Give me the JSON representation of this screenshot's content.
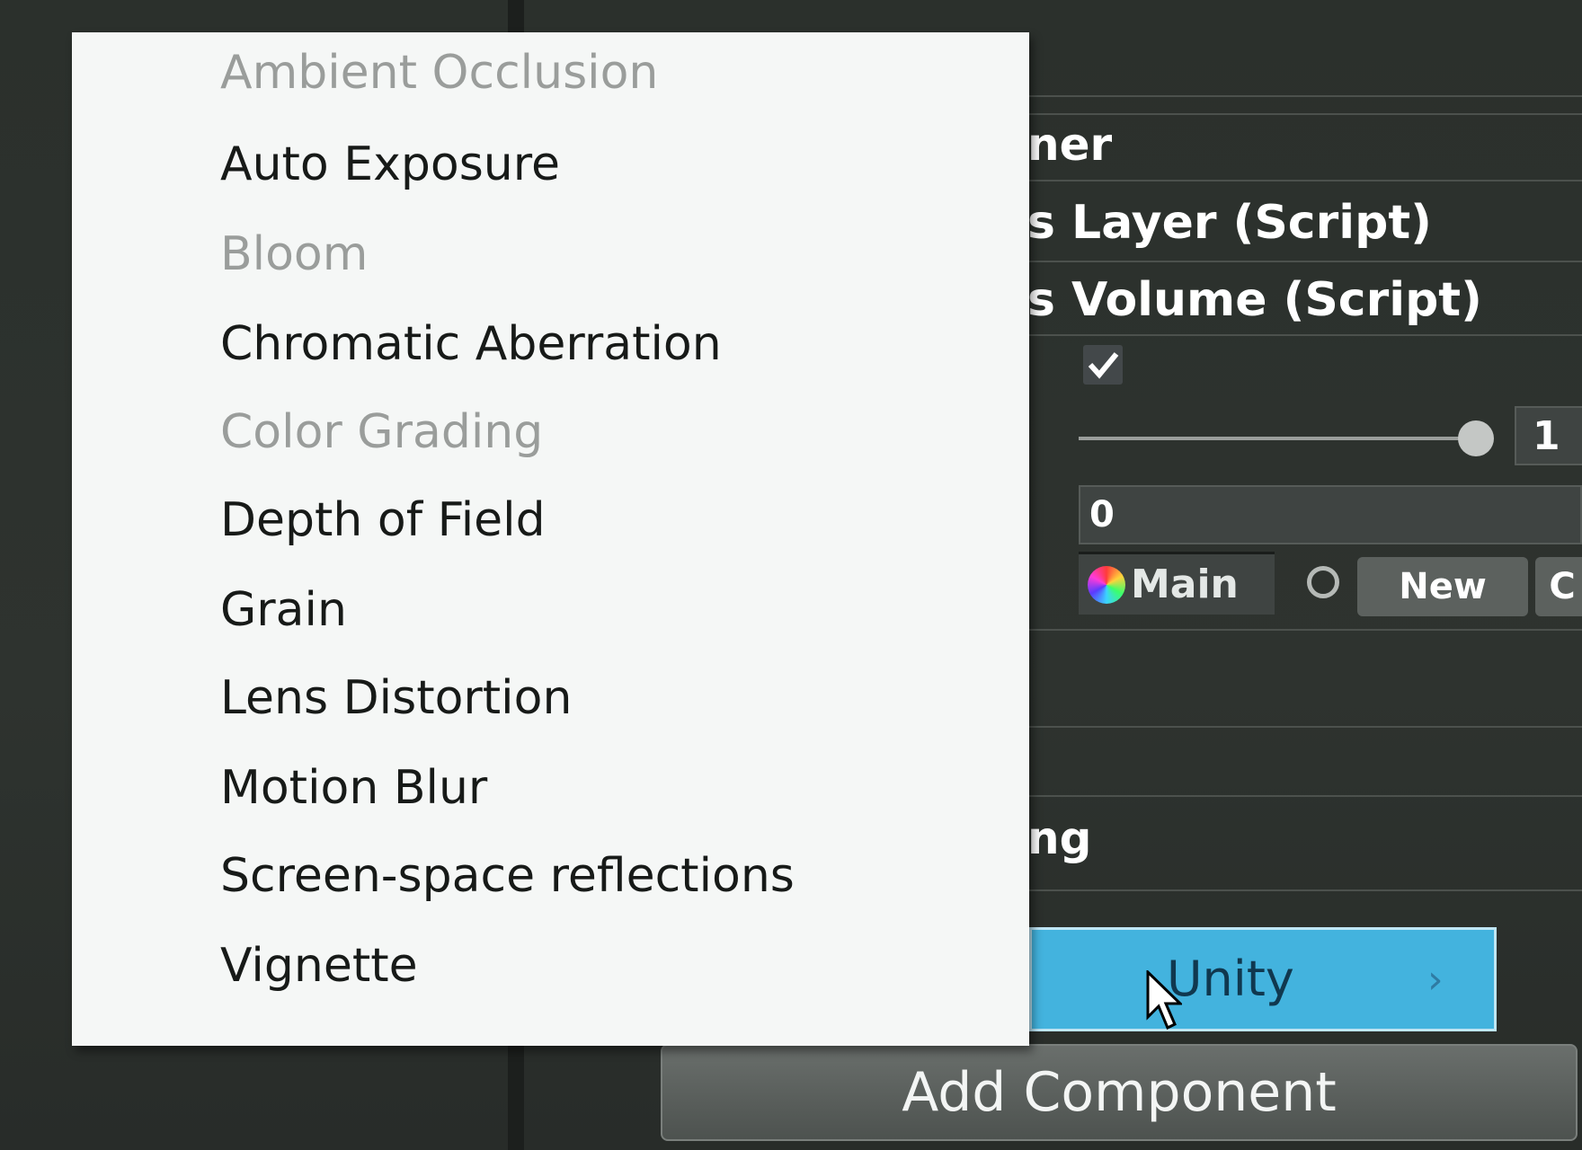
{
  "inspector": {
    "fragments": {
      "name_tail": "ner",
      "layer_component": "s Layer (Script)",
      "volume_component": "s Volume (Script)",
      "section_tail": "ng"
    },
    "is_global_checked": true,
    "weight": {
      "value": "1",
      "fraction": 1.0
    },
    "priority": {
      "value": "0"
    },
    "profile": {
      "value": "Main",
      "new_button": "New",
      "clone_button": "C"
    }
  },
  "context_menu": {
    "items": [
      {
        "label": "Ambient Occlusion",
        "enabled": false
      },
      {
        "label": "Auto Exposure",
        "enabled": true
      },
      {
        "label": "Bloom",
        "enabled": false
      },
      {
        "label": "Chromatic Aberration",
        "enabled": true
      },
      {
        "label": "Color Grading",
        "enabled": false
      },
      {
        "label": "Depth of Field",
        "enabled": true
      },
      {
        "label": "Grain",
        "enabled": true
      },
      {
        "label": "Lens Distortion",
        "enabled": true
      },
      {
        "label": "Motion Blur",
        "enabled": true
      },
      {
        "label": "Screen-space reflections",
        "enabled": true
      },
      {
        "label": "Vignette",
        "enabled": true
      }
    ]
  },
  "parent_menu": {
    "selected_item": "Unity",
    "submenu_arrow": "›"
  },
  "add_component_button": "Add Component",
  "colors": {
    "menu_background": "#f5f7f6",
    "highlight": "#43b3de",
    "panel_background": "#2e332f"
  },
  "icons": [
    "checkmark-icon",
    "color-wheel-icon",
    "radio-icon",
    "chevron-right-icon",
    "cursor-icon"
  ]
}
